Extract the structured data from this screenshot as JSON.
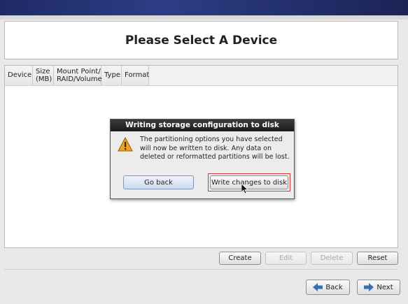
{
  "page": {
    "title": "Please Select A Device"
  },
  "table": {
    "columns": [
      {
        "label": "Device"
      },
      {
        "label_line1": "Size",
        "label_line2": "(MB)"
      },
      {
        "label_line1": "Mount Point/",
        "label_line2": "RAID/Volume"
      },
      {
        "label": "Type"
      },
      {
        "label": "Format"
      }
    ]
  },
  "dialog": {
    "title": "Writing storage configuration to disk",
    "message": "The partitioning options you have selected will now be written to disk.  Any data on deleted or reformatted partitions will be lost.",
    "go_back_label": "Go back",
    "write_label": "Write changes to disk",
    "icon": "warning-icon"
  },
  "actions": {
    "create_label": "Create",
    "edit_label": "Edit",
    "delete_label": "Delete",
    "reset_label": "Reset"
  },
  "nav": {
    "back_label": "Back",
    "next_label": "Next"
  },
  "colors": {
    "header_bar": "#1f2a66",
    "highlight": "#d23a3a",
    "warning": "#f0a321"
  }
}
